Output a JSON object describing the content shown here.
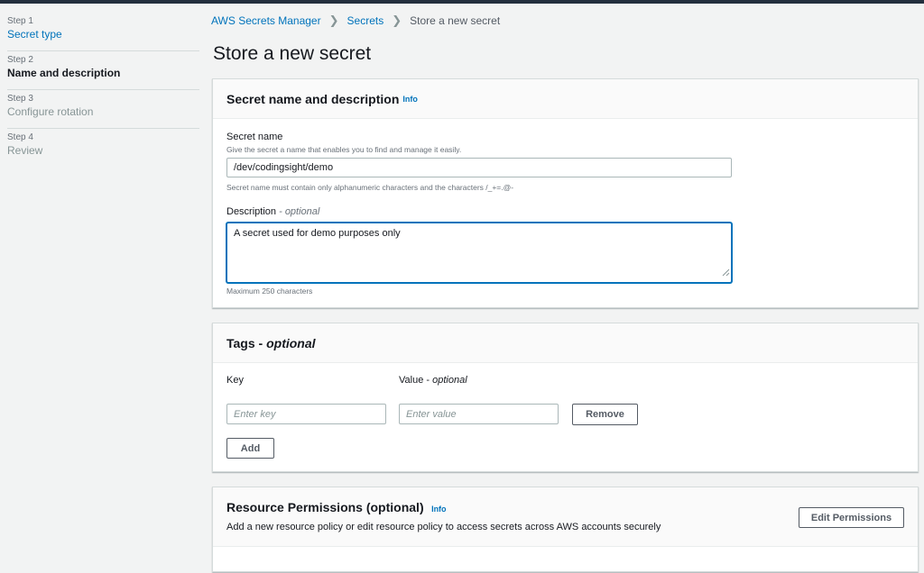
{
  "steps": [
    {
      "num": "Step 1",
      "label": "Secret type",
      "state": "link"
    },
    {
      "num": "Step 2",
      "label": "Name and description",
      "state": "current"
    },
    {
      "num": "Step 3",
      "label": "Configure rotation",
      "state": "disabled"
    },
    {
      "num": "Step 4",
      "label": "Review",
      "state": "disabled"
    }
  ],
  "breadcrumb": {
    "root": "AWS Secrets Manager",
    "section": "Secrets",
    "current": "Store a new secret"
  },
  "page_title": "Store a new secret",
  "secret_panel": {
    "title": "Secret name and description",
    "info": "Info",
    "name_label": "Secret name",
    "name_hint": "Give the secret a name that enables you to find and manage it easily.",
    "name_value": "/dev/codingsight/demo",
    "name_constraint": "Secret name must contain only alphanumeric characters and the characters /_+=.@-",
    "desc_label": "Description",
    "desc_optional": "- optional",
    "desc_value": "A secret used for demo purposes only",
    "desc_constraint": "Maximum 250 characters"
  },
  "tags_panel": {
    "title": "Tags -",
    "title_optional": "optional",
    "key_label": "Key",
    "value_label": "Value -",
    "value_optional": "optional",
    "key_placeholder": "Enter key",
    "value_placeholder": "Enter value",
    "remove_label": "Remove",
    "add_label": "Add"
  },
  "permissions_panel": {
    "title": "Resource Permissions (optional)",
    "info": "Info",
    "description": "Add a new resource policy or edit resource policy to access secrets across AWS accounts securely",
    "edit_label": "Edit Permissions"
  },
  "colors": {
    "link": "#0073bb",
    "focus": "#0073bb",
    "topbar": "#232f3e"
  }
}
